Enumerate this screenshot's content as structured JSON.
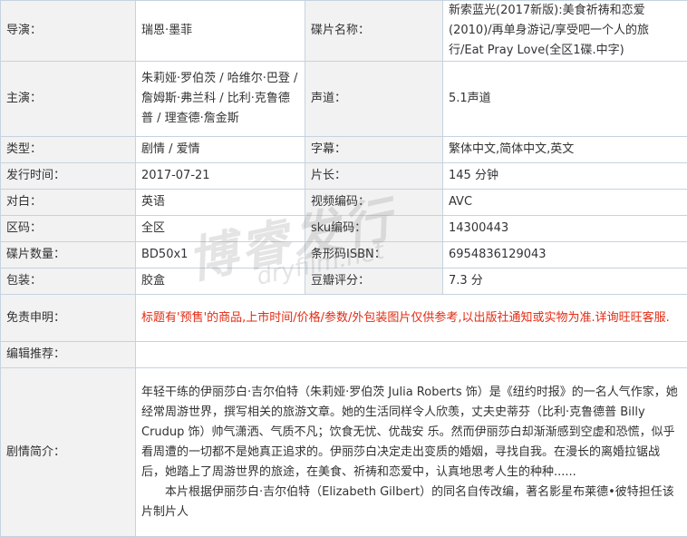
{
  "rows": {
    "director": {
      "label": "导演：",
      "value": "瑞恩·墨菲"
    },
    "disc_name": {
      "label": "碟片名称：",
      "value": "新索蓝光(2017新版):美食祈祷和恋爱(2010)/再单身游记/享受吧一个人的旅行/Eat Pray Love(全区1碟.中字)"
    },
    "cast": {
      "label": "主演：",
      "value": "朱莉娅·罗伯茨 / 哈维尔·巴登 / 詹姆斯·弗兰科 / 比利·克鲁德普 / 理查德·詹金斯"
    },
    "audio": {
      "label": "声道：",
      "value": "5.1声道"
    },
    "genre": {
      "label": "类型：",
      "value": "剧情 / 爱情"
    },
    "subtitles": {
      "label": "字幕：",
      "value": "繁体中文,简体中文,英文"
    },
    "release": {
      "label": "发行时间：",
      "value": "2017-07-21"
    },
    "runtime": {
      "label": "片长：",
      "value": "145 分钟"
    },
    "dialogue": {
      "label": "对白：",
      "value": "英语"
    },
    "video_codec": {
      "label": "视频编码：",
      "value": "AVC"
    },
    "region": {
      "label": "区码：",
      "value": "全区"
    },
    "sku": {
      "label": "sku编码：",
      "value": "14300443"
    },
    "disc_count": {
      "label": "碟片数量：",
      "value": "BD50x1"
    },
    "barcode": {
      "label": "条形码ISBN：",
      "value": "6954836129043"
    },
    "packaging": {
      "label": "包装：",
      "value": "胶盒"
    },
    "douban": {
      "label": "豆瓣评分：",
      "value": "7.3 分"
    },
    "disclaimer": {
      "label": "免责申明：",
      "value": "标题有'预售'的商品,上市时间/价格/参数/外包装图片仅供参考,以出版社通知或实物为准.详询旺旺客服."
    },
    "editor_pick": {
      "label": "编辑推荐：",
      "value": ""
    },
    "synopsis": {
      "label": "剧情简介：",
      "para1": "年轻干练的伊丽莎白·吉尔伯特（朱莉娅·罗伯茨 Julia Roberts 饰）是《纽约时报》的一名人气作家，她经常周游世界，撰写相关的旅游文章。她的生活同样令人欣羡，丈夫史蒂芬（比利·克鲁德普 Billy Crudup 饰）帅气潇洒、气质不凡；饮食无忧、优哉安 乐。然而伊丽莎白却渐渐感到空虚和恐慌，似乎看周遭的一切都不是她真正追求的。伊丽莎白决定走出变质的婚姻，寻找自我。在漫长的离婚拉锯战后，她踏上了周游世界的旅途，在美食、祈祷和恋爱中，认真地思考人生的种种......",
      "para2": "本片根据伊丽莎白·吉尔伯特（Elizabeth Gilbert）的同名自传改编，著名影星布莱德•彼特担任该片制片人"
    }
  },
  "watermark": {
    "text_big": "博睿发行",
    "text_small": "dryfilm.net",
    "color": "#6c6c6c"
  },
  "colors": {
    "border": "#c5d3df",
    "label_bg": "#f2f2f2",
    "disclaimer_text": "#e32b12"
  }
}
